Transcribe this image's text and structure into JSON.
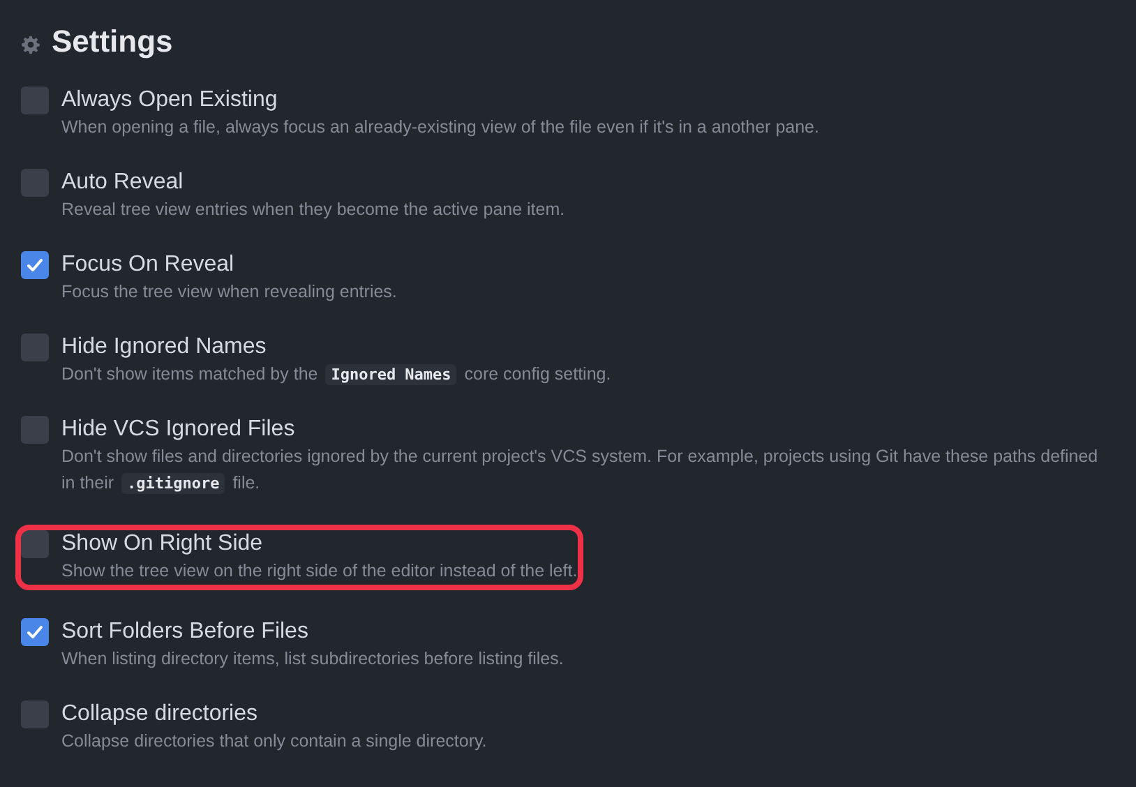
{
  "header": {
    "title": "Settings"
  },
  "settings": [
    {
      "title": "Always Open Existing",
      "checked": false,
      "highlighted": false,
      "description": [
        {
          "kind": "text",
          "text": "When opening a file, always focus an already-existing view of the file even if it's in a another pane."
        }
      ]
    },
    {
      "title": "Auto Reveal",
      "checked": false,
      "highlighted": false,
      "description": [
        {
          "kind": "text",
          "text": "Reveal tree view entries when they become the active pane item."
        }
      ]
    },
    {
      "title": "Focus On Reveal",
      "checked": true,
      "highlighted": false,
      "description": [
        {
          "kind": "text",
          "text": "Focus the tree view when revealing entries."
        }
      ]
    },
    {
      "title": "Hide Ignored Names",
      "checked": false,
      "highlighted": false,
      "description": [
        {
          "kind": "text",
          "text": "Don't show items matched by the "
        },
        {
          "kind": "code",
          "text": "Ignored Names"
        },
        {
          "kind": "text",
          "text": " core config setting."
        }
      ]
    },
    {
      "title": "Hide VCS Ignored Files",
      "checked": false,
      "highlighted": false,
      "description": [
        {
          "kind": "text",
          "text": "Don't show files and directories ignored by the current project's VCS system. For example, projects using Git have these paths defined in their "
        },
        {
          "kind": "code",
          "text": ".gitignore"
        },
        {
          "kind": "text",
          "text": " file."
        }
      ]
    },
    {
      "title": "Show On Right Side",
      "checked": false,
      "highlighted": true,
      "description": [
        {
          "kind": "text",
          "text": "Show the tree view on the right side of the editor instead of the left."
        }
      ]
    },
    {
      "title": "Sort Folders Before Files",
      "checked": true,
      "highlighted": false,
      "description": [
        {
          "kind": "text",
          "text": "When listing directory items, list subdirectories before listing files."
        }
      ]
    },
    {
      "title": "Collapse directories",
      "checked": false,
      "highlighted": false,
      "description": [
        {
          "kind": "text",
          "text": "Collapse directories that only contain a single directory."
        }
      ]
    }
  ]
}
